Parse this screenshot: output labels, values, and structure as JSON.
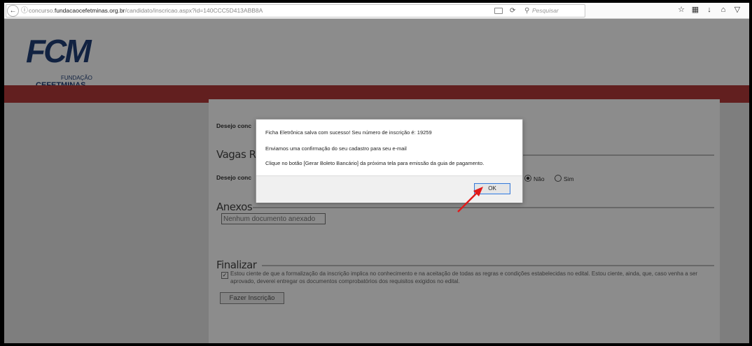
{
  "browser": {
    "url_prefix": "concurso.",
    "url_domain": "fundacaocefetminas.org.br",
    "url_path": "/candidato/inscricao.aspx?id=140CCC5D413ABB8A",
    "search_placeholder": "Pesquisar",
    "icons": [
      "back-icon",
      "info-icon",
      "reader-icon",
      "reload-icon",
      "search-icon",
      "bookmark-star-icon",
      "library-icon",
      "download-icon",
      "home-icon",
      "pocket-icon"
    ]
  },
  "logo": {
    "mark": "FCM",
    "line1": "FUNDAÇÃO",
    "line2": "CEFETMINAS"
  },
  "colors": {
    "brand_red": "#b23a3a",
    "brand_blue": "#1f3f77",
    "focus_blue": "#3d7bd4",
    "arrow_red": "#e01b1b"
  },
  "form": {
    "q1_label": "Desejo conc",
    "section_vagas": "Vagas Res",
    "q2_label": "Desejo conc",
    "radio_nao": "Não",
    "radio_sim": "Sim",
    "section_anexos": "Anexos",
    "no_docs": "Nenhum documento anexado",
    "section_finalizar": "Finalizar",
    "terms_text": "Estou ciente de que a formalização da inscrição implica no conhecimento e na aceitação de todas as regras e condições estabelecidas no edital. Estou ciente, ainda, que, caso venha a ser aprovado, deverei entregar os documentos comprobatórios dos requisitos exigidos no edital.",
    "submit_label": "Fazer Inscrição"
  },
  "dialog": {
    "line1": "Ficha Eletrônica salva com sucesso! Seu número de inscrição é: 19259",
    "line2": "Enviamos uma confirmação do seu cadastro para seu e-mail",
    "line3": "Clique no botão [Gerar Boleto Bancário] da próxima tela para emissão da guia de pagamento.",
    "ok_label": "OK"
  }
}
